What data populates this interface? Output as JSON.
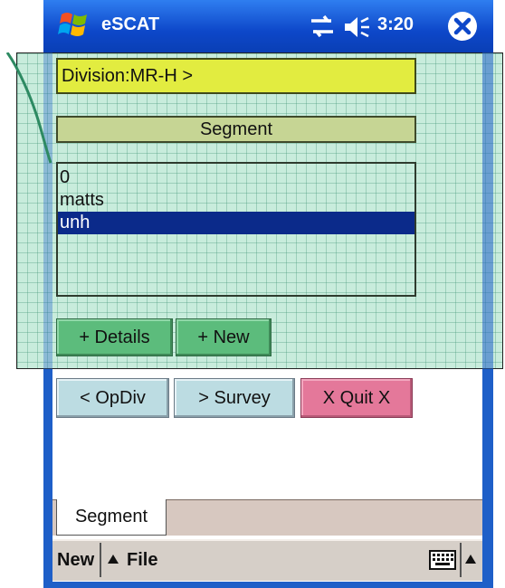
{
  "titlebar": {
    "app_title": "eSCAT",
    "time": "3:20",
    "icons": [
      "windows-start-icon",
      "connectivity-icon",
      "volume-icon",
      "close-icon"
    ]
  },
  "division": {
    "label": "Division:MR-H >"
  },
  "segment_header": {
    "label": "Segment"
  },
  "segment_list": {
    "items": [
      "0",
      "matts",
      "unh"
    ],
    "selected_index": 2
  },
  "actions": {
    "details_label": "+ Details",
    "new_label": "+ New"
  },
  "nav": {
    "opdiv_label": "< OpDiv",
    "survey_label": "> Survey",
    "quit_label": "X Quit X"
  },
  "tabs": [
    {
      "label": "Segment",
      "active": true
    }
  ],
  "menubar": {
    "new_label": "New",
    "file_label": "File",
    "icons": [
      "keyboard-icon",
      "input-menu-arrow-icon"
    ]
  },
  "colors": {
    "titlebar": "#0d47c9",
    "division_bg": "#e2ec40",
    "segment_header_bg": "#c6d594",
    "selection": "#0b2a8a",
    "action_buttons": "#5cbc7c",
    "nav_buttons": "#bcdce2",
    "quit_button": "#e4789a",
    "grid_panel": "#c8ecdc"
  }
}
